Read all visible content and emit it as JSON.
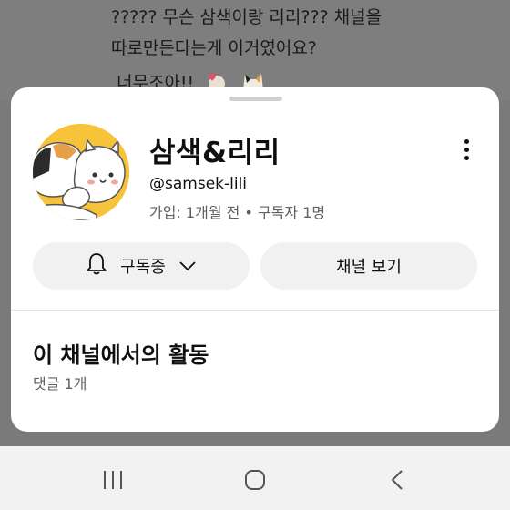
{
  "background_comment": {
    "line1": "????? 무슨 삼색이랑 리리??? 채널을",
    "line2": "따로만든다는게 이거였어요?",
    "line3": "너무조아!!"
  },
  "channel": {
    "name": "삼색&리리",
    "handle": "@samsek-lili",
    "meta": "가입: 1개월 전 • 구독자 1명",
    "avatar_alt": "calico-cat-avatar"
  },
  "actions": {
    "subscribe_label": "구독중",
    "view_channel_label": "채널 보기"
  },
  "activity": {
    "title": "이 채널에서의 활동",
    "subtitle": "댓글 1개"
  },
  "colors": {
    "sheet_bg": "#ffffff",
    "pill_bg": "#f1f1f1",
    "secondary_text": "#606060",
    "avatar_bg": "#f6c33a"
  },
  "icons": {
    "more": "more-vert-icon",
    "bell": "bell-icon",
    "chevron": "chevron-down-icon",
    "nav_recents": "recents-icon",
    "nav_home": "home-icon",
    "nav_back": "back-icon"
  }
}
